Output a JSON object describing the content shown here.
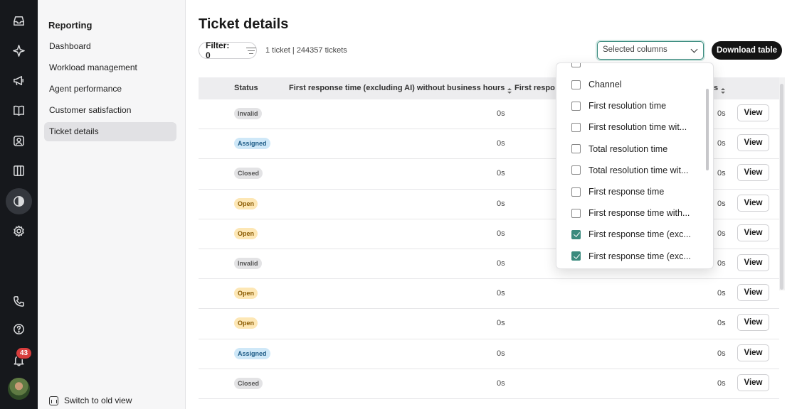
{
  "rail": {
    "items": [
      {
        "icon": "inbox-icon"
      },
      {
        "icon": "sparkle-icon"
      },
      {
        "icon": "megaphone-icon"
      },
      {
        "icon": "book-icon"
      },
      {
        "icon": "contact-icon"
      },
      {
        "icon": "columns-icon"
      },
      {
        "icon": "reports-icon"
      },
      {
        "icon": "gear-icon"
      },
      {
        "icon": "phone-icon"
      },
      {
        "icon": "help-icon"
      },
      {
        "icon": "bell-icon"
      }
    ],
    "notification_count": "43"
  },
  "subnav": {
    "title": "Reporting",
    "items": [
      {
        "label": "Dashboard"
      },
      {
        "label": "Workload management"
      },
      {
        "label": "Agent performance"
      },
      {
        "label": "Customer satisfaction"
      },
      {
        "label": "Ticket details",
        "active": true
      }
    ],
    "switch_label": "Switch to old view"
  },
  "main": {
    "title": "Ticket details",
    "filter_label": "Filter: 0",
    "ticket_count": "1 ticket | 244357 tickets",
    "columns_select": "Selected columns",
    "download_label": "Download table",
    "view_label": "View",
    "columns": {
      "status": "Status",
      "frt_excl_ai_no_bh": "First response time (excluding AI) without business hours",
      "frt_partial": "First respo",
      "tail": "s"
    },
    "rows": [
      {
        "status": "Invalid",
        "kind": "invalid",
        "v1": "0s",
        "v2": "0s"
      },
      {
        "status": "Assigned",
        "kind": "assigned",
        "v1": "0s",
        "v2": "0s"
      },
      {
        "status": "Closed",
        "kind": "closed",
        "v1": "0s",
        "v2": "0s"
      },
      {
        "status": "Open",
        "kind": "open",
        "v1": "0s",
        "v2": "0s"
      },
      {
        "status": "Open",
        "kind": "open",
        "v1": "0s",
        "v2": "0s"
      },
      {
        "status": "Invalid",
        "kind": "invalid",
        "v1": "0s",
        "v2": "0s"
      },
      {
        "status": "Open",
        "kind": "open",
        "v1": "0s",
        "v2": "0s"
      },
      {
        "status": "Open",
        "kind": "open",
        "v1": "0s",
        "v2": "0s"
      },
      {
        "status": "Assigned",
        "kind": "assigned",
        "v1": "0s",
        "v2": "0s"
      },
      {
        "status": "Closed",
        "kind": "closed",
        "v1": "0s",
        "v2": "0s"
      }
    ]
  },
  "dropdown": {
    "options": [
      {
        "label": "Channel",
        "checked": false
      },
      {
        "label": "First resolution time",
        "checked": false
      },
      {
        "label": "First resolution time wit...",
        "checked": false
      },
      {
        "label": "Total resolution time",
        "checked": false
      },
      {
        "label": "Total resolution time wit...",
        "checked": false
      },
      {
        "label": "First response time",
        "checked": false
      },
      {
        "label": "First response time with...",
        "checked": false
      },
      {
        "label": "First response time (exc...",
        "checked": true
      },
      {
        "label": "First response time (exc...",
        "checked": true
      }
    ]
  },
  "colors": {
    "accent": "#3a8a7d",
    "rail_bg": "#16181c",
    "badge": "#d83d3d"
  }
}
